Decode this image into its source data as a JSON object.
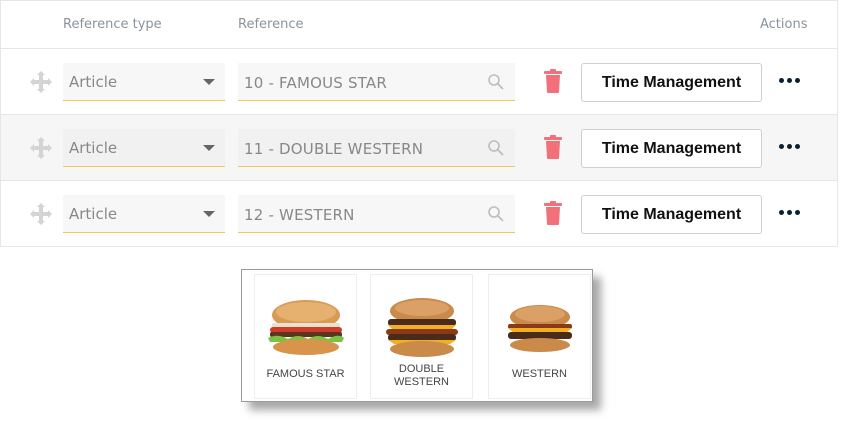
{
  "table": {
    "headers": {
      "reference_type": "Reference type",
      "reference": "Reference",
      "actions": "Actions"
    },
    "rows": [
      {
        "type": "Article",
        "reference": "10 - FAMOUS STAR",
        "time_button": "Time Management"
      },
      {
        "type": "Article",
        "reference": "11 - DOUBLE WESTERN",
        "time_button": "Time Management"
      },
      {
        "type": "Article",
        "reference": "12 - WESTERN",
        "time_button": "Time Management"
      }
    ]
  },
  "popup": {
    "items": [
      {
        "label": "FAMOUS STAR"
      },
      {
        "label_line1": "DOUBLE",
        "label_line2": "WESTERN"
      },
      {
        "label": "WESTERN"
      }
    ]
  },
  "icons": {
    "drag": "move-arrows-icon",
    "select_caret": "caret-down-icon",
    "search": "search-icon",
    "delete": "trash-icon",
    "more": "more-dots-icon"
  },
  "colors": {
    "accent_underline": "#f2c94c",
    "delete_red": "#f2707a",
    "more_dots": "#0b1f33"
  }
}
